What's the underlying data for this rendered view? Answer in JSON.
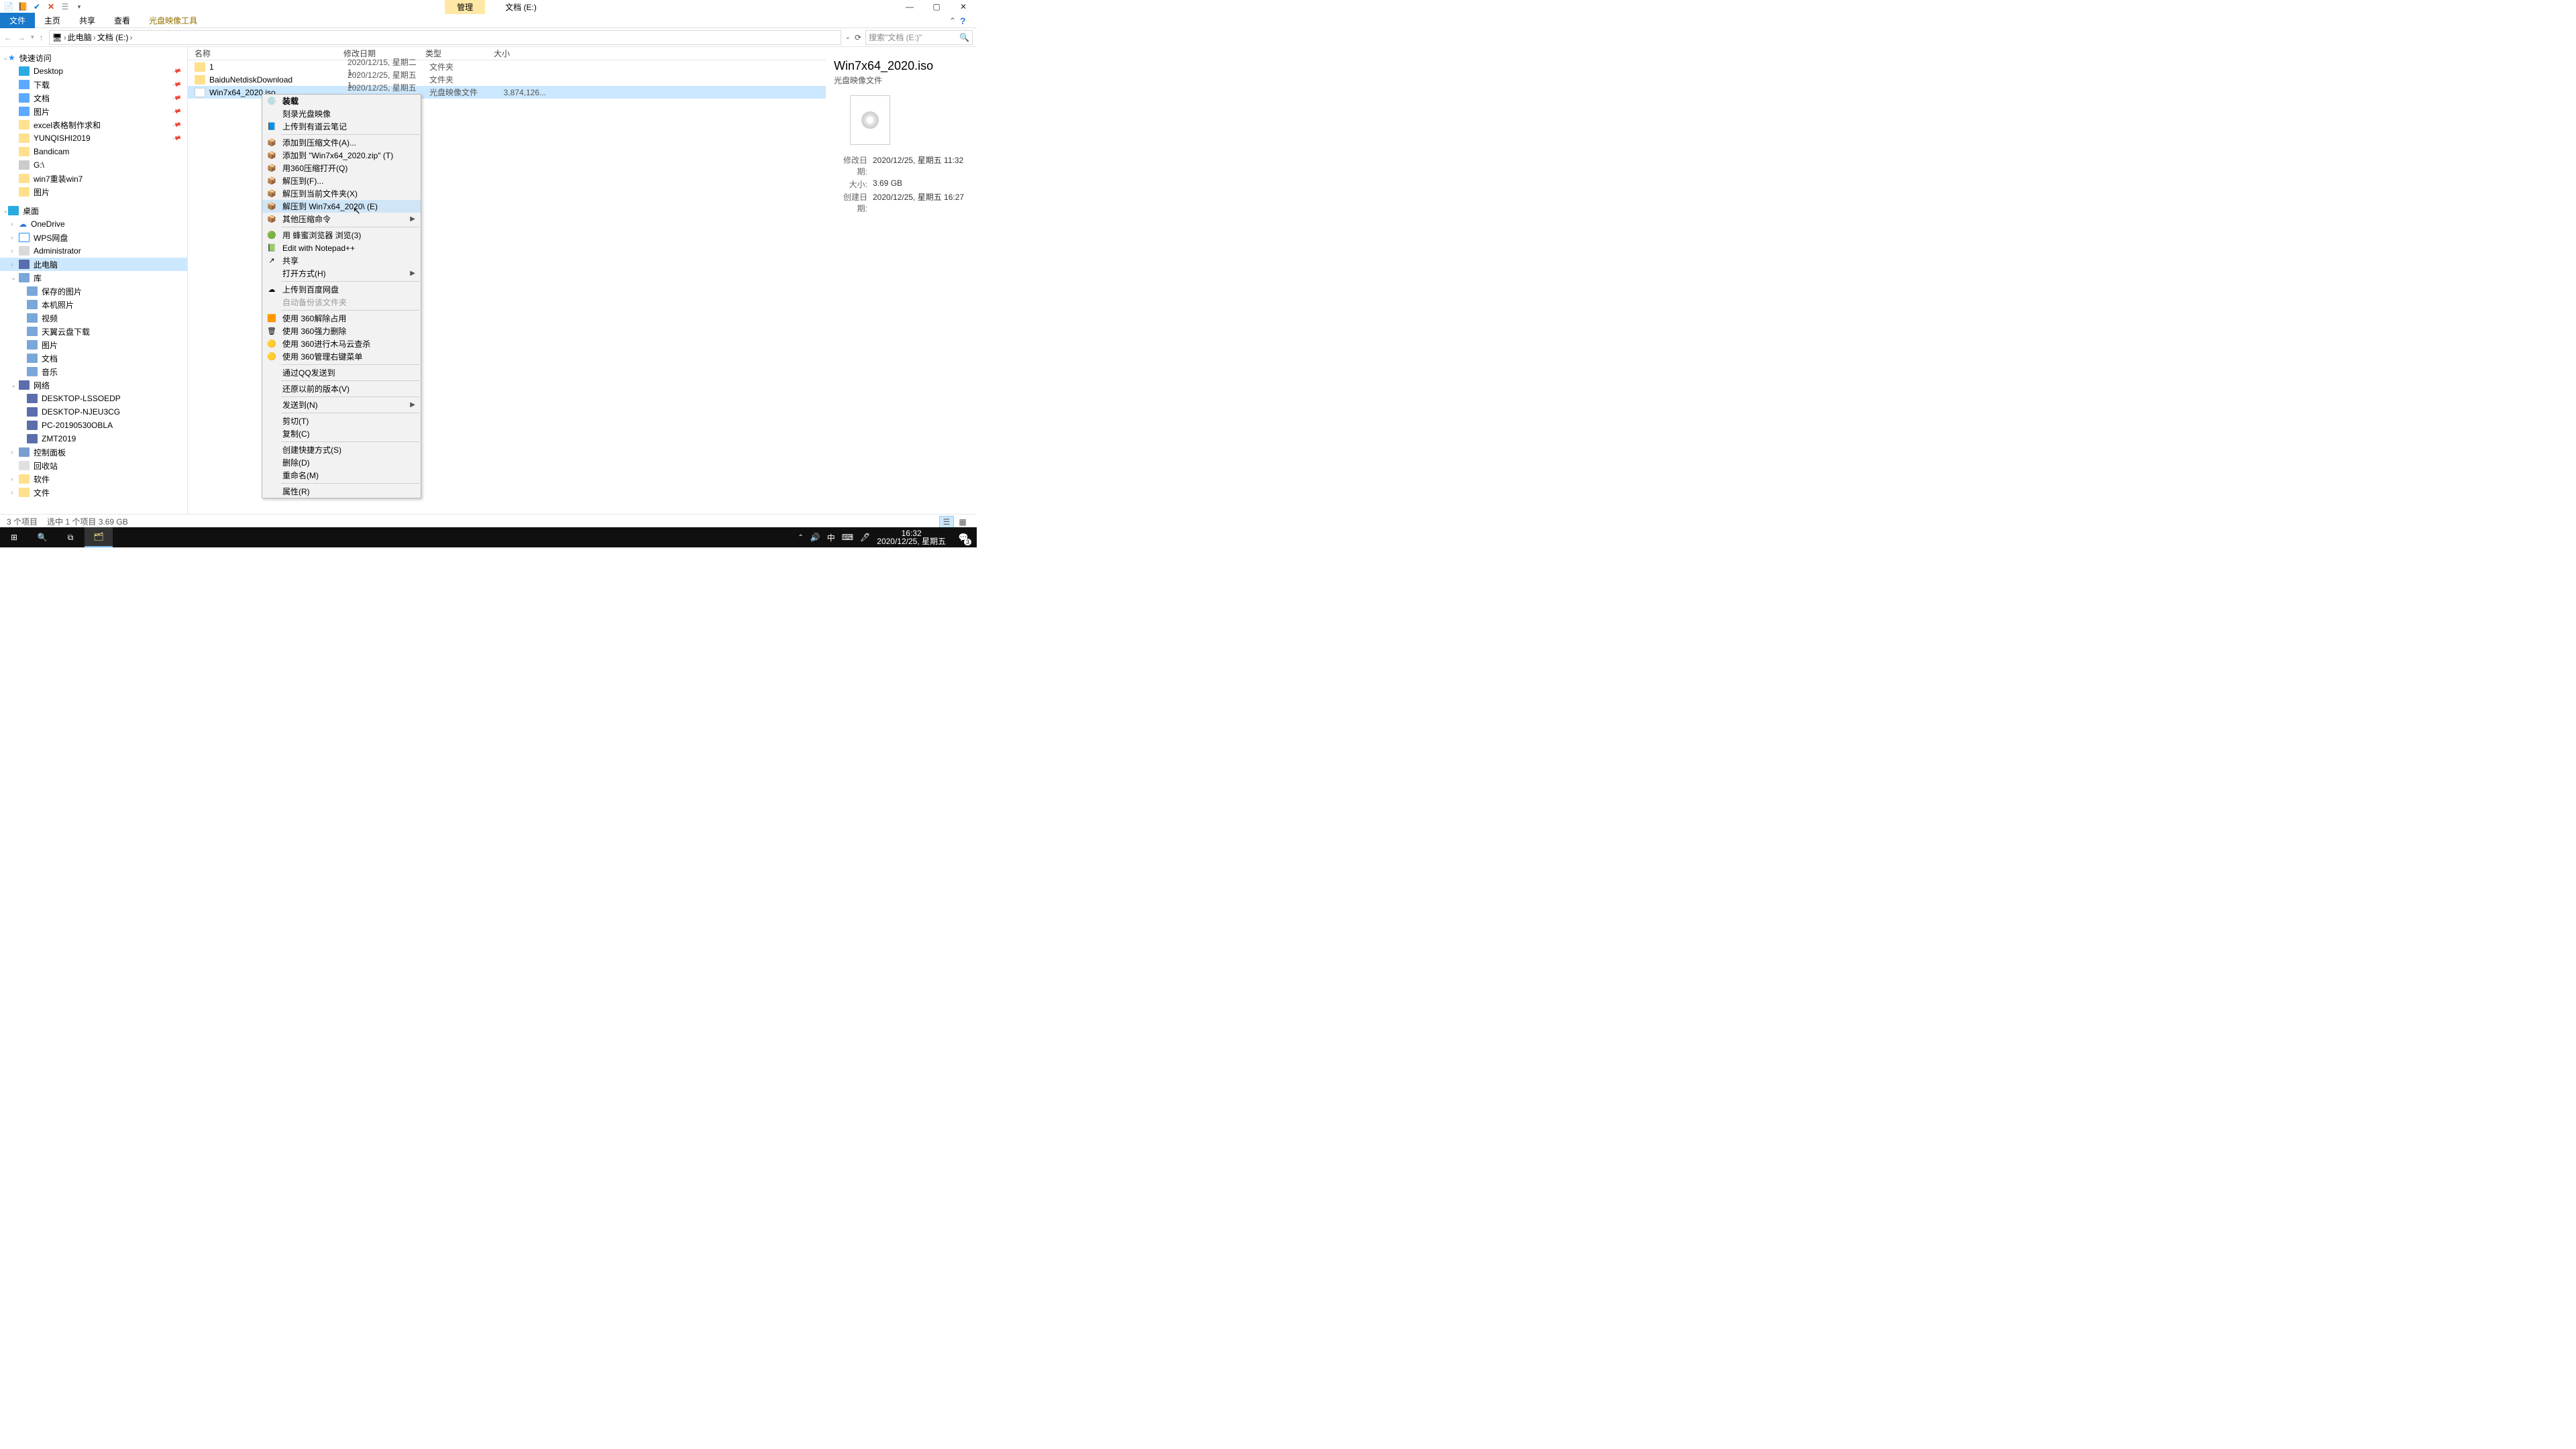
{
  "window": {
    "title_context_tab": "管理",
    "title": "文档 (E:)",
    "ribbon": {
      "file": "文件",
      "home": "主页",
      "share": "共享",
      "view": "查看",
      "iso_tools": "光盘映像工具"
    }
  },
  "breadcrumb": {
    "pc": "此电脑",
    "drive": "文档 (E:)"
  },
  "search": {
    "placeholder": "搜索\"文档 (E:)\""
  },
  "tree": {
    "quick_access": "快速访问",
    "desktop": "Desktop",
    "downloads": "下载",
    "documents": "文档",
    "pictures_local": "图片",
    "excel": "excel表格制作求和",
    "yunqishi": "YUNQISHI2019",
    "bandicam": "Bandicam",
    "gdrive": "G:\\",
    "win7_reinstall": "win7重装win7",
    "images": "图片",
    "desktop_root": "桌面",
    "onedrive": "OneDrive",
    "wps": "WPS网盘",
    "admin": "Administrator",
    "this_pc": "此电脑",
    "libraries": "库",
    "saved_pics": "保存的图片",
    "camera_roll": "本机照片",
    "videos": "视频",
    "tianyi": "天翼云盘下载",
    "lib_pics": "图片",
    "lib_docs": "文档",
    "lib_music": "音乐",
    "network": "网络",
    "net1": "DESKTOP-LSSOEDP",
    "net2": "DESKTOP-NJEU3CG",
    "net3": "PC-20190530OBLA",
    "net4": "ZMT2019",
    "control_panel": "控制面板",
    "recycle": "回收站",
    "soft": "软件",
    "files": "文件"
  },
  "columns": {
    "name": "名称",
    "date": "修改日期",
    "type": "类型",
    "size": "大小"
  },
  "rows": [
    {
      "name": "1",
      "date": "2020/12/15, 星期二 1...",
      "type": "文件夹",
      "size": ""
    },
    {
      "name": "BaiduNetdiskDownload",
      "date": "2020/12/25, 星期五 1...",
      "type": "文件夹",
      "size": ""
    },
    {
      "name": "Win7x64_2020.iso",
      "date": "2020/12/25, 星期五 1...",
      "type": "光盘映像文件",
      "size": "3,874,126..."
    }
  ],
  "context_menu": [
    {
      "label": "装载",
      "bold": true,
      "icon": "💿"
    },
    {
      "label": "刻录光盘映像"
    },
    {
      "label": "上传到有道云笔记",
      "icon": "📘"
    },
    {
      "sep": true
    },
    {
      "label": "添加到压缩文件(A)...",
      "icon": "📦"
    },
    {
      "label": "添加到 \"Win7x64_2020.zip\" (T)",
      "icon": "📦"
    },
    {
      "label": "用360压缩打开(Q)",
      "icon": "📦"
    },
    {
      "label": "解压到(F)...",
      "icon": "📦"
    },
    {
      "label": "解压到当前文件夹(X)",
      "icon": "📦"
    },
    {
      "label": "解压到 Win7x64_2020\\ (E)",
      "icon": "📦",
      "hl": true
    },
    {
      "label": "其他压缩命令",
      "icon": "📦",
      "arrow": true
    },
    {
      "sep": true
    },
    {
      "label": "用 蜂蜜浏览器 浏览(3)",
      "icon": "🟢"
    },
    {
      "label": "Edit with Notepad++",
      "icon": "📗"
    },
    {
      "label": "共享",
      "icon": "↗"
    },
    {
      "label": "打开方式(H)",
      "arrow": true
    },
    {
      "sep": true
    },
    {
      "label": "上传到百度网盘",
      "icon": "☁"
    },
    {
      "label": "自动备份该文件夹",
      "disabled": true
    },
    {
      "sep": true
    },
    {
      "label": "使用 360解除占用",
      "icon": "🟧"
    },
    {
      "label": "使用 360强力删除",
      "icon": "🗑"
    },
    {
      "label": "使用 360进行木马云查杀",
      "icon": "🟡"
    },
    {
      "label": "使用 360管理右键菜单",
      "icon": "🟡"
    },
    {
      "sep": true
    },
    {
      "label": "通过QQ发送到"
    },
    {
      "sep": true
    },
    {
      "label": "还原以前的版本(V)"
    },
    {
      "sep": true
    },
    {
      "label": "发送到(N)",
      "arrow": true
    },
    {
      "sep": true
    },
    {
      "label": "剪切(T)"
    },
    {
      "label": "复制(C)"
    },
    {
      "sep": true
    },
    {
      "label": "创建快捷方式(S)"
    },
    {
      "label": "删除(D)"
    },
    {
      "label": "重命名(M)"
    },
    {
      "sep": true
    },
    {
      "label": "属性(R)"
    }
  ],
  "details": {
    "title": "Win7x64_2020.iso",
    "type": "光盘映像文件",
    "mod_label": "修改日期:",
    "mod_val": "2020/12/25, 星期五 11:32",
    "size_label": "大小:",
    "size_val": "3.69 GB",
    "created_label": "创建日期:",
    "created_val": "2020/12/25, 星期五 16:27"
  },
  "status": {
    "items": "3 个项目",
    "selected": "选中 1 个项目  3.69 GB"
  },
  "taskbar": {
    "ime": "中",
    "time": "16:32",
    "date": "2020/12/25, 星期五",
    "notif": "3"
  }
}
